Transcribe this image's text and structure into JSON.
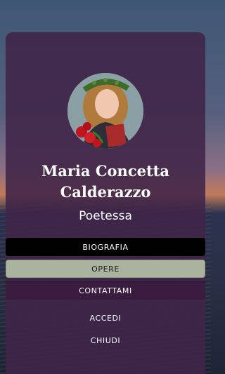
{
  "profile": {
    "name_line1": "Maria Concetta",
    "name_line2": "Calderazzo",
    "role": "Poetessa"
  },
  "menu": {
    "bio": "BIOGRAFIA",
    "works": "OPERE",
    "contact": "CONTATTAMI",
    "login": "ACCEDI",
    "close": "CHIUDI"
  },
  "colors": {
    "card": "#402448",
    "active_item": "#a9b39d",
    "bio_bg": "#000000"
  }
}
